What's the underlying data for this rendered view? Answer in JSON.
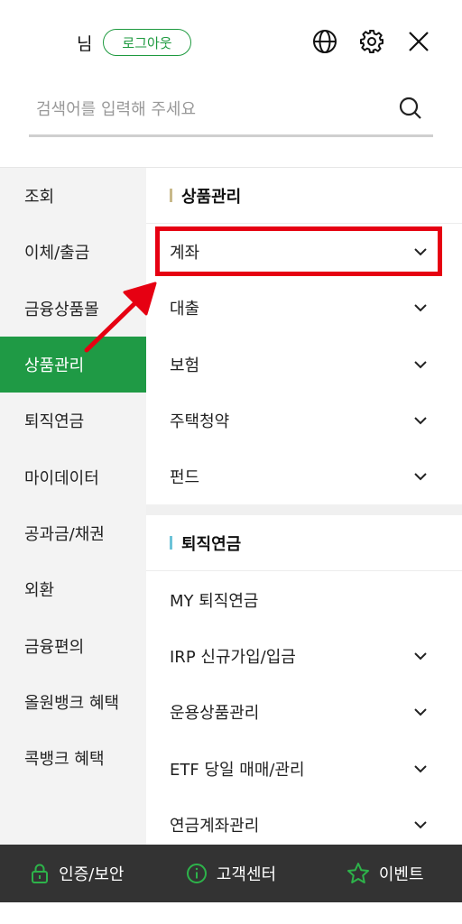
{
  "header": {
    "user_suffix": "님",
    "logout_label": "로그아웃",
    "search_placeholder": "검색어를 입력해 주세요",
    "icons": [
      "globe-icon",
      "gear-icon",
      "close-icon",
      "search-icon"
    ]
  },
  "sidebar": {
    "items": [
      {
        "label": "조회"
      },
      {
        "label": "이체/출금"
      },
      {
        "label": "금융상품몰"
      },
      {
        "label": "상품관리",
        "active": true
      },
      {
        "label": "퇴직연금"
      },
      {
        "label": "마이데이터"
      },
      {
        "label": "공과금/채권"
      },
      {
        "label": "외환"
      },
      {
        "label": "금융편의"
      },
      {
        "label": "올원뱅크 혜택"
      },
      {
        "label": "콕뱅크 혜택"
      }
    ]
  },
  "main": {
    "sections": [
      {
        "title": "상품관리",
        "bar_color": "#c8b98a",
        "items": [
          {
            "label": "계좌",
            "expandable": true,
            "highlighted": true
          },
          {
            "label": "대출",
            "expandable": true
          },
          {
            "label": "보험",
            "expandable": true
          },
          {
            "label": "주택청약",
            "expandable": true
          },
          {
            "label": "펀드",
            "expandable": true
          }
        ]
      },
      {
        "title": "퇴직연금",
        "bar_color": "#6cc3d8",
        "items": [
          {
            "label": "MY 퇴직연금",
            "expandable": false
          },
          {
            "label": "IRP 신규가입/입금",
            "expandable": true
          },
          {
            "label": "운용상품관리",
            "expandable": true
          },
          {
            "label": "ETF 당일 매매/관리",
            "expandable": true
          },
          {
            "label": "연금계좌관리",
            "expandable": true
          }
        ]
      }
    ]
  },
  "bottom_bar": {
    "items": [
      {
        "label": "인증/보안",
        "icon": "lock-icon"
      },
      {
        "label": "고객센터",
        "icon": "info-icon"
      },
      {
        "label": "이벤트",
        "icon": "star-icon"
      }
    ]
  },
  "colors": {
    "accent_green": "#1f9a45",
    "annotation_red": "#e60012",
    "bottom_bar": "#333333"
  }
}
